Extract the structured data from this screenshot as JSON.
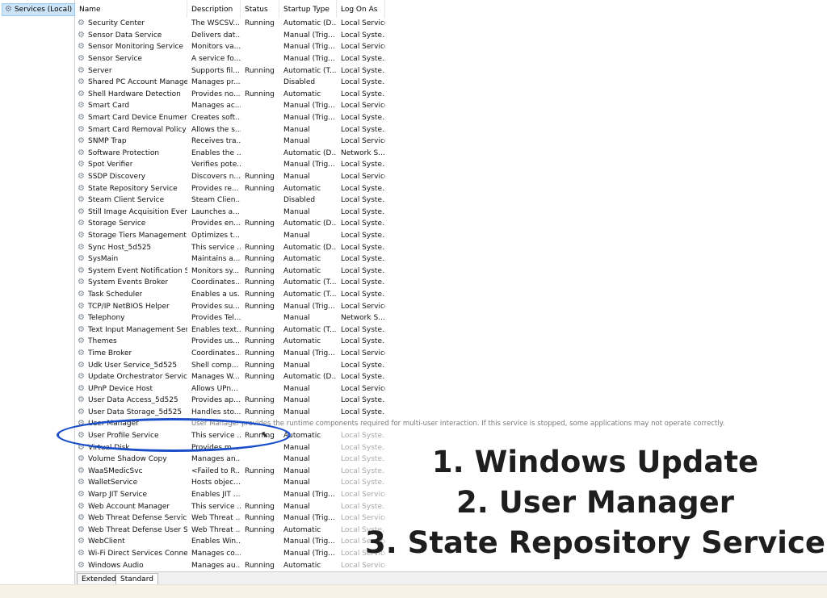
{
  "tree": {
    "root_label": "Services (Local)"
  },
  "columns": {
    "name": "Name",
    "description": "Description",
    "status": "Status",
    "startup": "Startup Type",
    "logon": "Log On As"
  },
  "services": [
    {
      "name": "Security Center",
      "desc": "The WSCSV...",
      "status": "Running",
      "startup": "Automatic (D...",
      "logon": "Local Service"
    },
    {
      "name": "Sensor Data Service",
      "desc": "Delivers dat...",
      "status": "",
      "startup": "Manual (Trig...",
      "logon": "Local Syste..."
    },
    {
      "name": "Sensor Monitoring Service",
      "desc": "Monitors va...",
      "status": "",
      "startup": "Manual (Trig...",
      "logon": "Local Service"
    },
    {
      "name": "Sensor Service",
      "desc": "A service fo...",
      "status": "",
      "startup": "Manual (Trig...",
      "logon": "Local Syste..."
    },
    {
      "name": "Server",
      "desc": "Supports fil...",
      "status": "Running",
      "startup": "Automatic (T...",
      "logon": "Local Syste..."
    },
    {
      "name": "Shared PC Account Manager",
      "desc": "Manages pr...",
      "status": "",
      "startup": "Disabled",
      "logon": "Local Syste..."
    },
    {
      "name": "Shell Hardware Detection",
      "desc": "Provides no...",
      "status": "Running",
      "startup": "Automatic",
      "logon": "Local Syste..."
    },
    {
      "name": "Smart Card",
      "desc": "Manages ac...",
      "status": "",
      "startup": "Manual (Trig...",
      "logon": "Local Service"
    },
    {
      "name": "Smart Card Device Enumera...",
      "desc": "Creates soft...",
      "status": "",
      "startup": "Manual (Trig...",
      "logon": "Local Syste..."
    },
    {
      "name": "Smart Card Removal Policy",
      "desc": "Allows the s...",
      "status": "",
      "startup": "Manual",
      "logon": "Local Syste..."
    },
    {
      "name": "SNMP Trap",
      "desc": "Receives tra...",
      "status": "",
      "startup": "Manual",
      "logon": "Local Service"
    },
    {
      "name": "Software Protection",
      "desc": "Enables the ...",
      "status": "",
      "startup": "Automatic (D...",
      "logon": "Network S..."
    },
    {
      "name": "Spot Verifier",
      "desc": "Verifies pote...",
      "status": "",
      "startup": "Manual (Trig...",
      "logon": "Local Syste..."
    },
    {
      "name": "SSDP Discovery",
      "desc": "Discovers n...",
      "status": "Running",
      "startup": "Manual",
      "logon": "Local Service"
    },
    {
      "name": "State Repository Service",
      "desc": "Provides re...",
      "status": "Running",
      "startup": "Automatic",
      "logon": "Local Syste..."
    },
    {
      "name": "Steam Client Service",
      "desc": "Steam Clien...",
      "status": "",
      "startup": "Disabled",
      "logon": "Local Syste..."
    },
    {
      "name": "Still Image Acquisition Events",
      "desc": "Launches a...",
      "status": "",
      "startup": "Manual",
      "logon": "Local Syste..."
    },
    {
      "name": "Storage Service",
      "desc": "Provides en...",
      "status": "Running",
      "startup": "Automatic (D...",
      "logon": "Local Syste..."
    },
    {
      "name": "Storage Tiers Management",
      "desc": "Optimizes t...",
      "status": "",
      "startup": "Manual",
      "logon": "Local Syste..."
    },
    {
      "name": "Sync Host_5d525",
      "desc": "This service ...",
      "status": "Running",
      "startup": "Automatic (D...",
      "logon": "Local Syste..."
    },
    {
      "name": "SysMain",
      "desc": "Maintains a...",
      "status": "Running",
      "startup": "Automatic",
      "logon": "Local Syste..."
    },
    {
      "name": "System Event Notification S...",
      "desc": "Monitors sy...",
      "status": "Running",
      "startup": "Automatic",
      "logon": "Local Syste..."
    },
    {
      "name": "System Events Broker",
      "desc": "Coordinates...",
      "status": "Running",
      "startup": "Automatic (T...",
      "logon": "Local Syste..."
    },
    {
      "name": "Task Scheduler",
      "desc": "Enables a us...",
      "status": "Running",
      "startup": "Automatic (T...",
      "logon": "Local Syste..."
    },
    {
      "name": "TCP/IP NetBIOS Helper",
      "desc": "Provides su...",
      "status": "Running",
      "startup": "Manual (Trig...",
      "logon": "Local Service"
    },
    {
      "name": "Telephony",
      "desc": "Provides Tel...",
      "status": "",
      "startup": "Manual",
      "logon": "Network S..."
    },
    {
      "name": "Text Input Management Ser...",
      "desc": "Enables text...",
      "status": "Running",
      "startup": "Automatic (T...",
      "logon": "Local Syste..."
    },
    {
      "name": "Themes",
      "desc": "Provides us...",
      "status": "Running",
      "startup": "Automatic",
      "logon": "Local Syste..."
    },
    {
      "name": "Time Broker",
      "desc": "Coordinates...",
      "status": "Running",
      "startup": "Manual (Trig...",
      "logon": "Local Service"
    },
    {
      "name": "Udk User Service_5d525",
      "desc": "Shell comp...",
      "status": "Running",
      "startup": "Manual",
      "logon": "Local Syste..."
    },
    {
      "name": "Update Orchestrator Service",
      "desc": "Manages W...",
      "status": "Running",
      "startup": "Automatic (D...",
      "logon": "Local Syste..."
    },
    {
      "name": "UPnP Device Host",
      "desc": "Allows UPn...",
      "status": "",
      "startup": "Manual",
      "logon": "Local Service"
    },
    {
      "name": "User Data Access_5d525",
      "desc": "Provides ap...",
      "status": "Running",
      "startup": "Manual",
      "logon": "Local Syste..."
    },
    {
      "name": "User Data Storage_5d525",
      "desc": "Handles sto...",
      "status": "Running",
      "startup": "Manual",
      "logon": "Local Syste..."
    },
    {
      "name": "User Manager",
      "desc": "",
      "status": "",
      "startup": "",
      "logon": "",
      "tooltip": "User Manager provides the runtime components required for multi-user interaction.  If this service is stopped, some applications may not operate correctly."
    },
    {
      "name": "User Profile Service",
      "desc": "This service ...",
      "status": "Running",
      "startup": "Automatic",
      "logon": "Local Syste..."
    },
    {
      "name": "Virtual Disk",
      "desc": "Provides m...",
      "status": "",
      "startup": "Manual",
      "logon": "Local Syste..."
    },
    {
      "name": "Volume Shadow Copy",
      "desc": "Manages an...",
      "status": "",
      "startup": "Manual",
      "logon": "Local Syste..."
    },
    {
      "name": "WaaSMedicSvc",
      "desc": "<Failed to R...",
      "status": "Running",
      "startup": "Manual",
      "logon": "Local Syste..."
    },
    {
      "name": "WalletService",
      "desc": "Hosts objec...",
      "status": "",
      "startup": "Manual",
      "logon": "Local Syste..."
    },
    {
      "name": "Warp JIT Service",
      "desc": "Enables JIT ...",
      "status": "",
      "startup": "Manual (Trig...",
      "logon": "Local Service"
    },
    {
      "name": "Web Account Manager",
      "desc": "This service ...",
      "status": "Running",
      "startup": "Manual",
      "logon": "Local Syste..."
    },
    {
      "name": "Web Threat Defense Service",
      "desc": "Web Threat ...",
      "status": "Running",
      "startup": "Manual (Trig...",
      "logon": "Local Service"
    },
    {
      "name": "Web Threat Defense User Se...",
      "desc": "Web Threat ...",
      "status": "Running",
      "startup": "Automatic",
      "logon": "Local Syste..."
    },
    {
      "name": "WebClient",
      "desc": "Enables Win...",
      "status": "",
      "startup": "Manual (Trig...",
      "logon": "Local Service"
    },
    {
      "name": "Wi-Fi Direct Services Conne...",
      "desc": "Manages co...",
      "status": "",
      "startup": "Manual (Trig...",
      "logon": "Local Service"
    },
    {
      "name": "Windows Audio",
      "desc": "Manages au...",
      "status": "Running",
      "startup": "Automatic",
      "logon": "Local Service"
    }
  ],
  "overlay_lines": [
    "1. Windows Update",
    "2. User Manager",
    "3. State Repository Service"
  ],
  "tabs": {
    "extended": "Extended",
    "standard": "Standard"
  },
  "colors": {
    "highlight_ellipse": "#1b4ec9",
    "overlay_text": "#1e1e1e"
  }
}
